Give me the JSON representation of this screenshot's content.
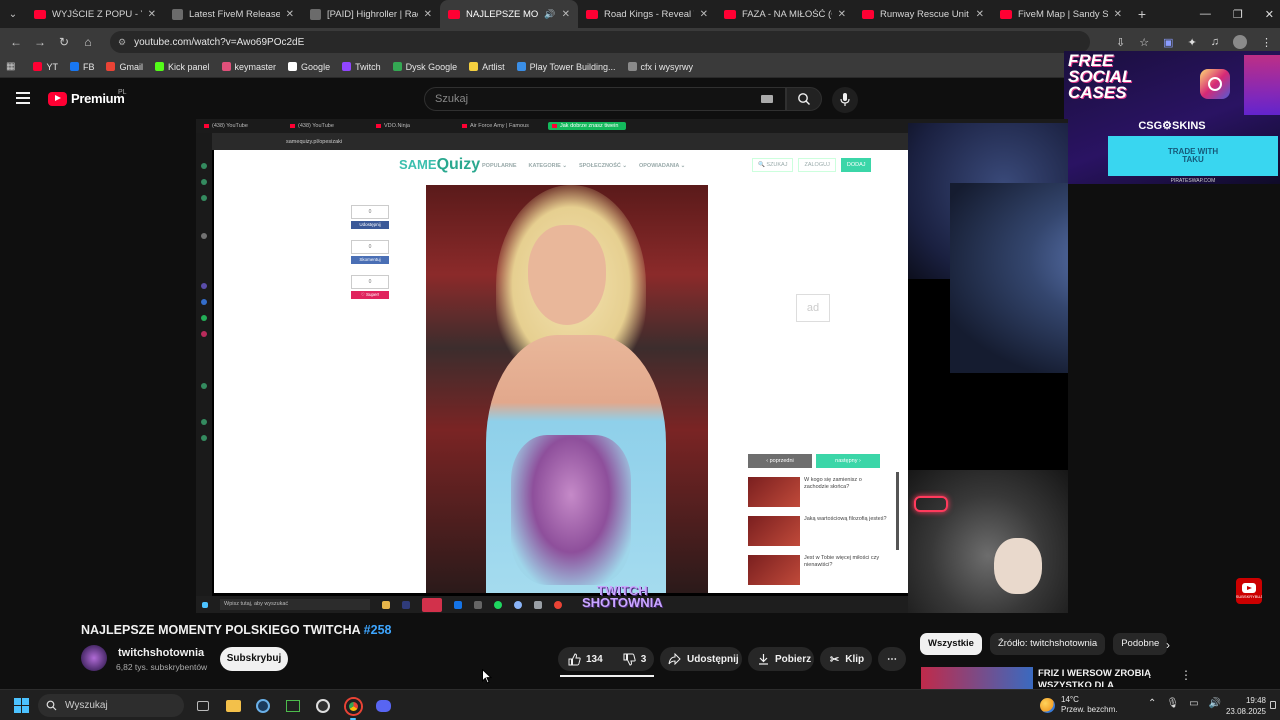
{
  "browser": {
    "tabs": [
      {
        "title": "WYJŚCIE Z POPU - YouTube",
        "fav": "yt",
        "active": false
      },
      {
        "title": "Latest FiveM Releases top",
        "fav": "doc",
        "active": false
      },
      {
        "title": "[PAID] Highroller | Racing",
        "fav": "doc",
        "active": false
      },
      {
        "title": "NAJLEPSZE MOMENT",
        "fav": "yt",
        "active": true
      },
      {
        "title": "Road Kings - Reveal Trailer",
        "fav": "yt",
        "active": false
      },
      {
        "title": "FAZA - NA MIŁOŚĆ (Offic",
        "fav": "yt",
        "active": false
      },
      {
        "title": "Runway Rescue Unit - Five",
        "fav": "yt",
        "active": false
      },
      {
        "title": "FiveM Map | Sandy Shore",
        "fav": "yt",
        "active": false
      }
    ],
    "url": "youtube.com/watch?v=Awo69POc2dE",
    "bookmarks": [
      {
        "label": "YT",
        "color": "#ff0033"
      },
      {
        "label": "FB",
        "color": "#1877f2"
      },
      {
        "label": "Gmail",
        "color": "#ea4335"
      },
      {
        "label": "Kick panel",
        "color": "#53fc18"
      },
      {
        "label": "keymaster",
        "color": "#e0507a"
      },
      {
        "label": "Google",
        "color": "#ffffff"
      },
      {
        "label": "Twitch",
        "color": "#9146ff"
      },
      {
        "label": "Dysk Google",
        "color": "#34a853"
      },
      {
        "label": "Artlist",
        "color": "#f4d03f"
      },
      {
        "label": "Play Tower Building...",
        "color": "#3a8ee6"
      },
      {
        "label": "cfx i wysyrwy",
        "color": "#8a8a8a"
      }
    ]
  },
  "youtube": {
    "brand": "Premium",
    "region": "PL",
    "search_placeholder": "Szukaj",
    "video_title": "NAJLEPSZE MOMENTY POLSKIEGO TWITCHA",
    "video_tag": "#258",
    "channel_name": "twitchshotownia",
    "channel_subs": "6,82 tys. subskrybentów",
    "subscribe_label": "Subskrybuj",
    "likes": "134",
    "dislikes": "3",
    "share_label": "Udostępnij",
    "download_label": "Pobierz",
    "clip_label": "Klip",
    "chips": [
      "Wszystkie",
      "Źródło: twitchshotownia",
      "Podobne"
    ],
    "rec_title": "FRIZ I WERSOW ZROBIĄ WSZYSTKO DLA PIENIĘDZY?"
  },
  "video": {
    "inner_tabs": [
      "(438) YouTube",
      "(438) YouTube",
      "VDO.Ninja",
      "Air Force Amy | Famous",
      "Jak dobrze znasz tiwein"
    ],
    "inner_url": "samequizy.pl/opesizaki",
    "site_logo_a": "SAME",
    "site_logo_b": "Quizy",
    "site_nav": [
      "POPULARNE",
      "KATEGORIE ⌄",
      "SPOŁECZNOŚĆ ⌄",
      "OPOWIADANIA ⌄"
    ],
    "site_btns": [
      "🔍 SZUKAJ",
      "ZALOGUJ",
      "DODAJ"
    ],
    "share_blocks": [
      {
        "count": "0",
        "label": "Udostępnij",
        "color": "#3b5998"
      },
      {
        "count": "0",
        "label": "Skomentuj",
        "color": "#4a6fb5"
      },
      {
        "count": "0",
        "label": "♡ Super!",
        "color": "#e0245e"
      }
    ],
    "ad_label": "ad",
    "pager_prev": "‹ poprzedni",
    "pager_next": "następny ›",
    "quiz_items": [
      "W kogo się zamienisz o zachodzie słońca?",
      "Jaką wartościową filozofią jesteś?",
      "Jest w Tobie więcej miłości czy nienawiści?"
    ],
    "inner_taskbar_search": "Wpisz tutaj, aby wyszukać",
    "watermark": "TWITCH\nSHOTOWNIA",
    "promo_title": "FREE\nSOCIAL\nCASES",
    "promo_brand": "CSG⚙SKINS",
    "promo_trade": "TRADE WITH\nTAKU",
    "promo_sub": "PIRATESWAP.COM",
    "sub_badge": "SUBSKRYBUJ"
  },
  "taskbar": {
    "search_placeholder": "Wyszukaj",
    "weather_temp": "14°C",
    "weather_desc": "Przew. bezchm.",
    "time": "19:48",
    "date": "23.08.2025"
  }
}
